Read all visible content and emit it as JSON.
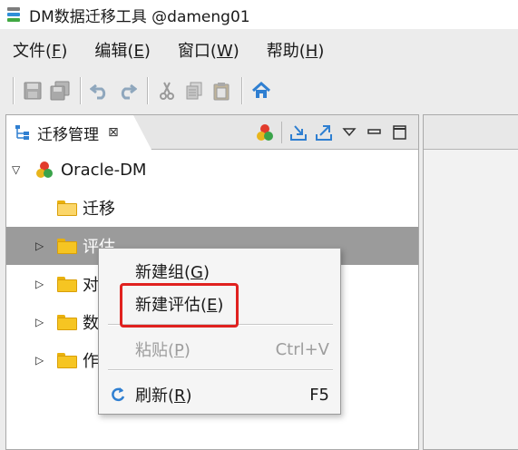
{
  "window": {
    "title": "DM数据迁移工具 @dameng01"
  },
  "menubar": {
    "items": [
      {
        "text": "文件(",
        "mn": "F",
        "end": ")"
      },
      {
        "text": "编辑(",
        "mn": "E",
        "end": ")"
      },
      {
        "text": "窗口(",
        "mn": "W",
        "end": ")"
      },
      {
        "text": "帮助(",
        "mn": "H",
        "end": ")"
      }
    ]
  },
  "toolbar": {
    "icons": [
      "save-icon",
      "save-all-icon",
      "undo-icon",
      "redo-icon",
      "cut-icon",
      "copy-icon",
      "paste-icon",
      "home-icon"
    ]
  },
  "view": {
    "tab_label": "迁移管理",
    "close_glyph": "⊠",
    "actions": [
      "connect-icon",
      "import-icon",
      "export-icon",
      "view-menu-icon",
      "minimize-icon",
      "maximize-icon"
    ]
  },
  "tree": {
    "root": "Oracle-DM",
    "items": [
      {
        "label": "迁移"
      },
      {
        "label": "评估"
      },
      {
        "label": "对"
      },
      {
        "label": "数"
      },
      {
        "label": "作"
      }
    ]
  },
  "context_menu": {
    "new_group": {
      "text": "新建组(",
      "mn": "G",
      "end": ")"
    },
    "new_assessment": {
      "text": "新建评估(",
      "mn": "E",
      "end": ")"
    },
    "paste": {
      "text": "粘贴(",
      "mn": "P",
      "end": ")",
      "shortcut": "Ctrl+V"
    },
    "refresh": {
      "text": "刷新(",
      "mn": "R",
      "end": ")",
      "shortcut": "F5"
    }
  },
  "colors": {
    "highlight_border": "#e0211f",
    "selected_row": "#9b9b9b",
    "accent_blue": "#2f7fd1"
  }
}
